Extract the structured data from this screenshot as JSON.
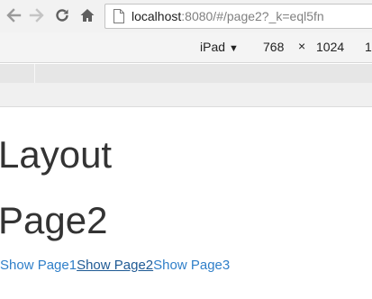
{
  "browser": {
    "back_icon": "back-arrow-icon",
    "forward_icon": "forward-arrow-icon",
    "reload_icon": "reload-icon",
    "home_icon": "home-icon",
    "page_icon": "page-icon",
    "url_host": "localhost",
    "url_rest": ":8080/#/page2?_k=eql5fn"
  },
  "device_toolbar": {
    "device": "iPad",
    "caret": "▼",
    "width": "768",
    "times": "×",
    "height": "1024",
    "zoom": "1"
  },
  "page": {
    "heading": "Layout",
    "subheading": "Page2",
    "links": [
      {
        "label": "Show Page1",
        "active": false
      },
      {
        "label": "Show Page2",
        "active": true
      },
      {
        "label": "Show Page3",
        "active": false
      }
    ]
  },
  "colors": {
    "link": "#2f7fc9",
    "active_link": "#1f5a94",
    "heading": "#333333"
  }
}
